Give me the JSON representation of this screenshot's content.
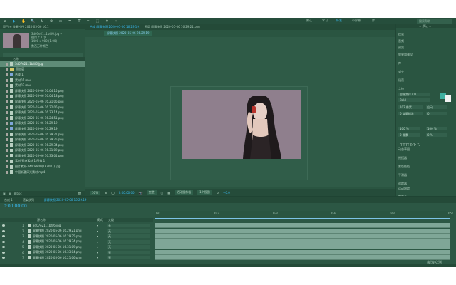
{
  "toolbar": {
    "tools": [
      "⌂",
      "▶",
      "✋",
      "🔍",
      "↻",
      "⊕",
      "▭",
      "✒",
      "T",
      "✏",
      "⬚",
      "✦",
      "⌖"
    ],
    "workspaces": [
      "默认",
      "学习",
      "标准",
      "小屏幕",
      "库"
    ],
    "active_workspace": "标准",
    "search_placeholder": "搜索帮助"
  },
  "project": {
    "tab": "项目 ≡ 效果控件 2020-05-06 16.1",
    "filename": "3d07e21..1b4f6.jpg ▾",
    "info1": "使用了 1 次",
    "info2": "1400 x 900 (1.00)",
    "info3": "数百万种颜色",
    "column_header": "名称",
    "items": [
      {
        "name": "3d07e21..1b4f6.jpg",
        "type": "img",
        "selected": true
      },
      {
        "name": "固态层",
        "type": "folder"
      },
      {
        "name": "合成 1",
        "type": "comp"
      },
      {
        "name": "素材01.mov",
        "type": "img"
      },
      {
        "name": "素材02.mov",
        "type": "img"
      },
      {
        "name": "屏幕快照 2020-05-06 16.04.15.png",
        "type": "img"
      },
      {
        "name": "屏幕快照 2020-05-06 16.04.18.png",
        "type": "img"
      },
      {
        "name": "屏幕快照 2020-05-06 16.21.06.png",
        "type": "img"
      },
      {
        "name": "屏幕快照 2020-05-06 16.22.06.png",
        "type": "img"
      },
      {
        "name": "屏幕快照 2020-05-06 16.23.14.png",
        "type": "img"
      },
      {
        "name": "屏幕快照 2020-05-06 16.24.51.png",
        "type": "img"
      },
      {
        "name": "屏幕快照 2020-05-06 16.29.19",
        "type": "comp"
      },
      {
        "name": "屏幕快照 2020-05-06 16.29.19",
        "type": "comp"
      },
      {
        "name": "屏幕快照 2020-05-06 16.29.21.png",
        "type": "img"
      },
      {
        "name": "屏幕快照 2020-05-06 16.29.25.png",
        "type": "img"
      },
      {
        "name": "屏幕快照 2020-05-06 16.29.34.png",
        "type": "img"
      },
      {
        "name": "屏幕快照 2020-05-06 16.31.09.png",
        "type": "img"
      },
      {
        "name": "屏幕快照 2020-05-06 16.33.04.png",
        "type": "img"
      },
      {
        "name": "素材 亚洲素材 1 图像 1",
        "type": "img"
      },
      {
        "name": "图片素材-1440x900(187087).jpg",
        "type": "img"
      },
      {
        "name": "中国新疆风光素材.mp4",
        "type": "img"
      }
    ],
    "footer": "8 bpc"
  },
  "viewer": {
    "tabs": [
      "合成 屏幕快照 2020-05-06 16.29.19",
      "图层 屏幕快照 2020-05-06 16.29.21.png"
    ],
    "breadcrumb": "屏幕快照 2020-05-06 16.29.19",
    "zoom": "50%",
    "timecode": "0:00:00:00",
    "resolution": "完整",
    "camera": "活动摄像机",
    "views": "1个视图",
    "exposure": "+0.0"
  },
  "right_panel": {
    "header": "≡ 默认 ≡",
    "items": [
      "信息",
      "音频",
      "预览",
      "效果和预设",
      "库",
      "对齐",
      "段落"
    ],
    "character": {
      "title": "字符",
      "font": "思源黑体 CN",
      "style": "Bold",
      "size": "102 像素",
      "leading": "自动",
      "kerning": "0 度量标准",
      "tracking": "0",
      "vscale": "100 %",
      "hscale": "100 %",
      "baseline": "0 像素",
      "tsume": "0 %",
      "styles": "T T TT Tr T¹ T₁"
    },
    "lower_items": [
      "动态草图",
      "摇摆器",
      "蒙版插值",
      "平滑器",
      "追踪器",
      "运动跟踪",
      "字符画"
    ]
  },
  "timeline": {
    "tabs": [
      "合成 1",
      "渲染队列",
      "屏幕快照 2020-05-06 16.29.19"
    ],
    "timecode": "0:00:00:00",
    "col_name": "源名称",
    "col_mode": "模式",
    "col_parent": "父级",
    "ruler": [
      "0s",
      "01s",
      "02s",
      "03s",
      "04s",
      "05s"
    ],
    "layers": [
      {
        "num": "1",
        "name": "3d07e21..1b4f6.jpg",
        "parent": "无"
      },
      {
        "num": "2",
        "name": "屏幕快照 2020-05-06 16.29.21.png",
        "parent": "无"
      },
      {
        "num": "3",
        "name": "屏幕快照 2020-05-06 16.29.25.png",
        "parent": "无"
      },
      {
        "num": "4",
        "name": "屏幕快照 2020-05-06 16.29.34.png",
        "parent": "无"
      },
      {
        "num": "5",
        "name": "屏幕快照 2020-05-06 16.31.09.png",
        "parent": "无"
      },
      {
        "num": "6",
        "name": "屏幕快照 2020-05-06 16.33.04.png",
        "parent": "无"
      },
      {
        "num": "7",
        "name": "屏幕快照 2020-05-06 16.21.06.png",
        "parent": "无"
      }
    ]
  },
  "watermark": "新浪众测",
  "colors": {
    "accent": "#37b9f0",
    "panel": "#2a5541",
    "selected": "#5f8c78"
  }
}
